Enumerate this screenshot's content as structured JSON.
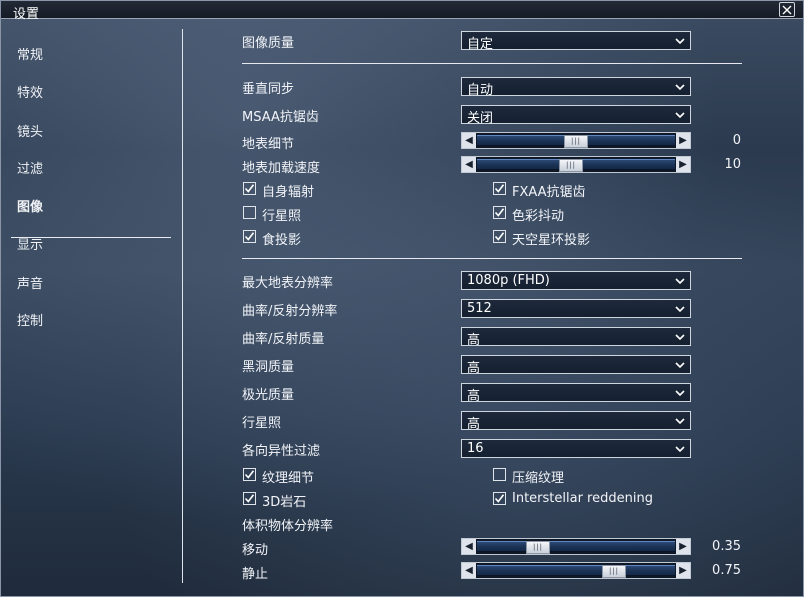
{
  "window": {
    "title": "设置"
  },
  "sidebar": {
    "items": [
      {
        "label": "常规"
      },
      {
        "label": "特效"
      },
      {
        "label": "镜头"
      },
      {
        "label": "过滤"
      },
      {
        "label": "图像"
      },
      {
        "label": "显示"
      },
      {
        "label": "声音"
      },
      {
        "label": "控制"
      }
    ],
    "active": "图像"
  },
  "main": {
    "image_quality": {
      "label": "图像质量",
      "value": "自定"
    },
    "vsync": {
      "label": "垂直同步",
      "value": "自动"
    },
    "msaa": {
      "label": "MSAA抗锯齿",
      "value": "关闭"
    },
    "terrain_detail": {
      "label": "地表细节",
      "value": "0",
      "fraction": 0.5
    },
    "terrain_load_speed": {
      "label": "地表加载速度",
      "value": "10",
      "fraction": 0.47
    },
    "checks_group1": [
      {
        "label": "自身辐射",
        "checked": true
      },
      {
        "label": "FXAA抗锯齿",
        "checked": true
      },
      {
        "label": "行星照",
        "checked": false
      },
      {
        "label": "色彩抖动",
        "checked": true
      },
      {
        "label": "食投影",
        "checked": true
      },
      {
        "label": "天空星环投影",
        "checked": true
      }
    ],
    "max_terrain_res": {
      "label": "最大地表分辨率",
      "value": "1080p (FHD)"
    },
    "refl_res": {
      "label": "曲率/反射分辨率",
      "value": "512"
    },
    "refl_quality": {
      "label": "曲率/反射质量",
      "value": "高"
    },
    "blackhole_quality": {
      "label": "黑洞质量",
      "value": "高"
    },
    "aurora_quality": {
      "label": "极光质量",
      "value": "高"
    },
    "planetshine": {
      "label": "行星照",
      "value": "高"
    },
    "aniso": {
      "label": "各向异性过滤",
      "value": "16"
    },
    "checks_group2": [
      {
        "label": "纹理细节",
        "checked": true
      },
      {
        "label": "压缩纹理",
        "checked": false
      },
      {
        "label": "3D岩石",
        "checked": true
      },
      {
        "label": "Interstellar reddening",
        "checked": true
      }
    ],
    "volumetric_res": {
      "label": "体积物体分辨率"
    },
    "moving": {
      "label": "移动",
      "value": "0.35",
      "fraction": 0.28
    },
    "static": {
      "label": "静止",
      "value": "0.75",
      "fraction": 0.72
    }
  },
  "icons": {
    "close": "close-icon",
    "dropdown": "chevron-down-icon",
    "slider_left": "arrow-left-icon",
    "slider_right": "arrow-right-icon",
    "check": "checkmark-icon"
  }
}
